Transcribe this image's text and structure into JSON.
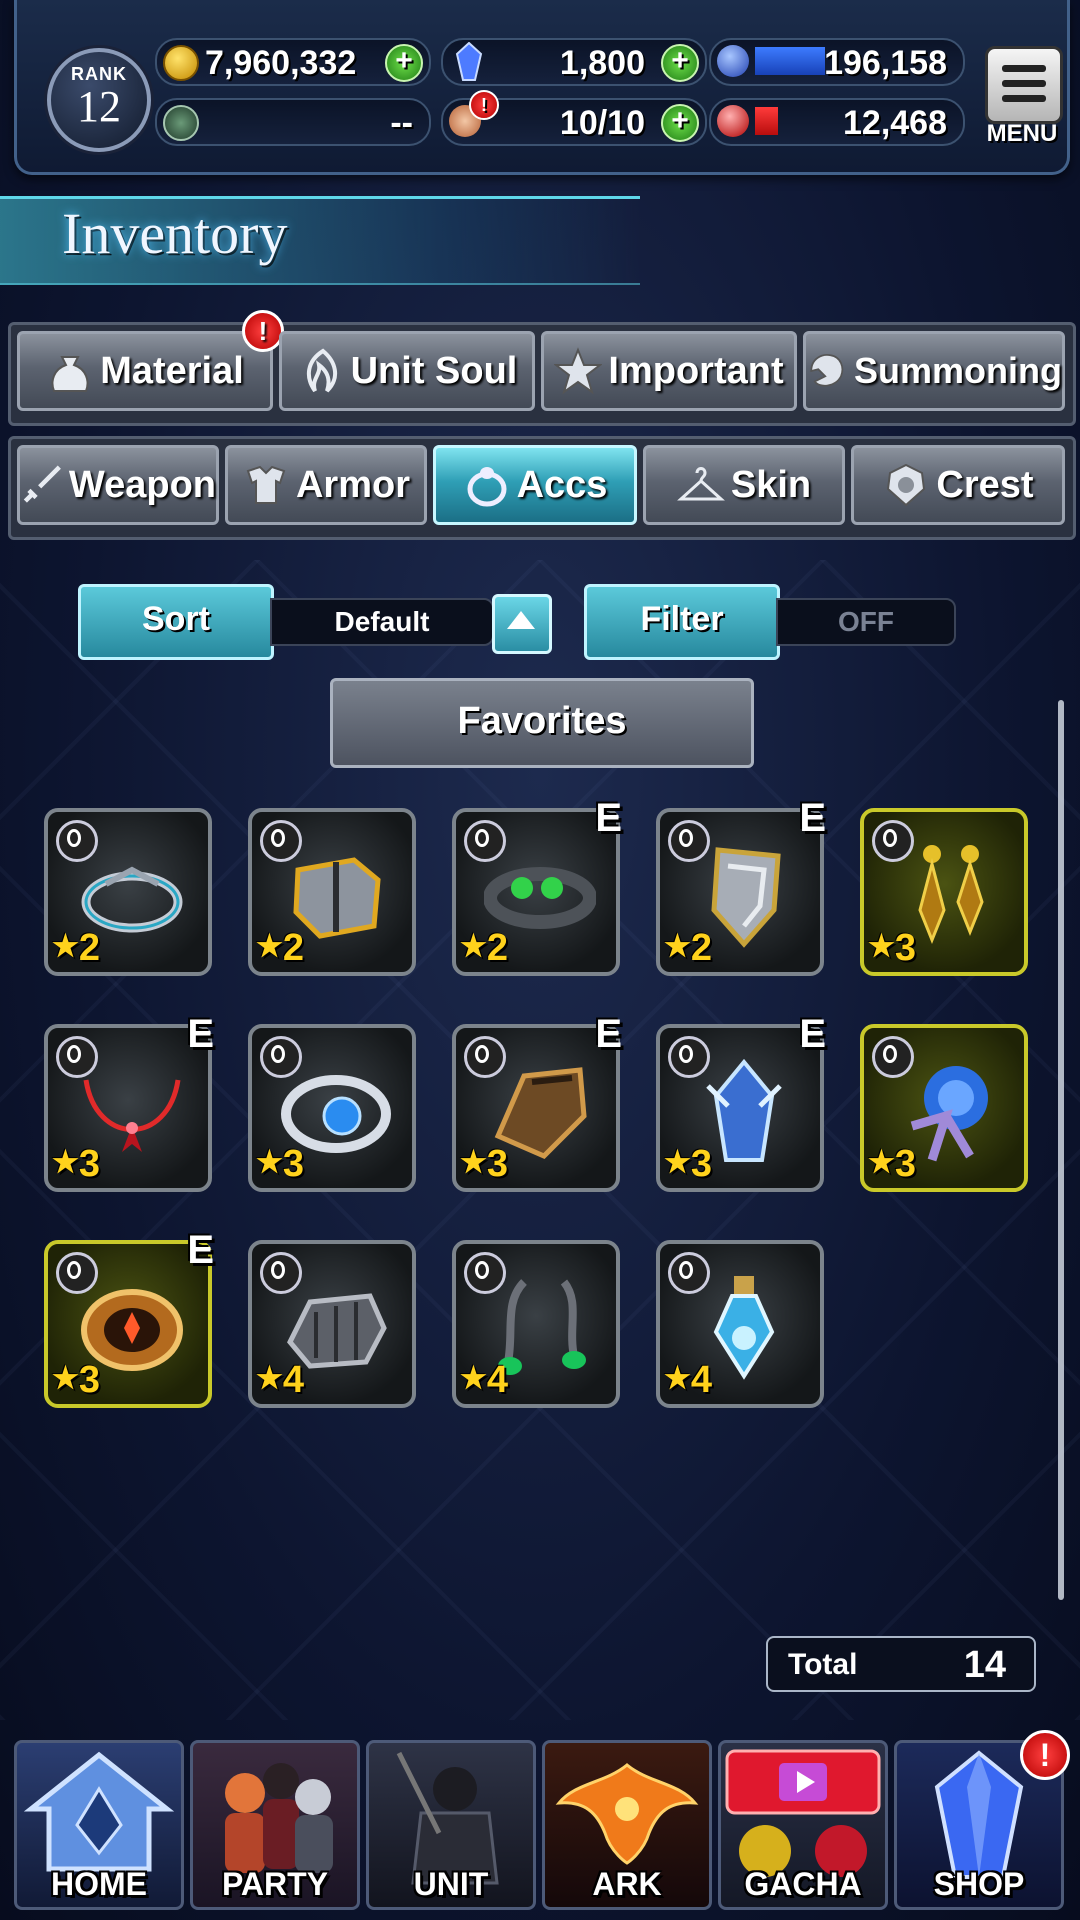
{
  "header": {
    "rank_label": "RANK",
    "rank_value": "12",
    "gil": "7,960,332",
    "lapis": "1,800",
    "blue_value": "196,158",
    "blue_bar_fraction": 0.45,
    "sword_value": "--",
    "stamina": "10/10",
    "red_value": "12,468",
    "red_bar_fraction": 0.15,
    "menu_label": "MENU"
  },
  "title": "Inventory",
  "tabs_row1": [
    {
      "label": "Material",
      "icon": "bag-icon",
      "badge": "!"
    },
    {
      "label": "Unit Soul",
      "icon": "soul-flame-icon"
    },
    {
      "label": "Important",
      "icon": "star-icon"
    },
    {
      "label": "Summoning",
      "icon": "summon-crest-icon"
    }
  ],
  "tabs_row2": [
    {
      "label": "Weapon",
      "icon": "sword-icon"
    },
    {
      "label": "Armor",
      "icon": "armor-icon"
    },
    {
      "label": "Accs",
      "icon": "ring-icon",
      "active": true
    },
    {
      "label": "Skin",
      "icon": "hanger-icon"
    },
    {
      "label": "Crest",
      "icon": "crest-icon"
    }
  ],
  "sort": {
    "button": "Sort",
    "value": "Default"
  },
  "filter": {
    "button": "Filter",
    "value": "OFF"
  },
  "favorites_label": "Favorites",
  "items": [
    {
      "rarity": "2",
      "equipped": false,
      "gold": false,
      "art": "silver-blue-ring"
    },
    {
      "rarity": "2",
      "equipped": false,
      "gold": false,
      "art": "gold-silver-gauntlet"
    },
    {
      "rarity": "2",
      "equipped": true,
      "gold": false,
      "art": "green-gem-bracelet"
    },
    {
      "rarity": "2",
      "equipped": true,
      "gold": false,
      "art": "silver-shield-bracer"
    },
    {
      "rarity": "3",
      "equipped": false,
      "gold": true,
      "art": "gold-earrings"
    },
    {
      "rarity": "3",
      "equipped": true,
      "gold": false,
      "art": "red-necklace"
    },
    {
      "rarity": "3",
      "equipped": false,
      "gold": false,
      "art": "blue-gem-ring"
    },
    {
      "rarity": "3",
      "equipped": true,
      "gold": false,
      "art": "bronze-gauntlet"
    },
    {
      "rarity": "3",
      "equipped": true,
      "gold": false,
      "art": "ice-crystal-bracer"
    },
    {
      "rarity": "3",
      "equipped": false,
      "gold": true,
      "art": "blue-rose-corsage"
    },
    {
      "rarity": "3",
      "equipped": true,
      "gold": true,
      "art": "ornate-bangle"
    },
    {
      "rarity": "4",
      "equipped": false,
      "gold": false,
      "art": "iron-gauntlet"
    },
    {
      "rarity": "4",
      "equipped": false,
      "gold": false,
      "art": "emerald-earrings"
    },
    {
      "rarity": "4",
      "equipped": false,
      "gold": false,
      "art": "crystal-vial"
    }
  ],
  "equipped_mark": "E",
  "total": {
    "label": "Total",
    "value": "14"
  },
  "nav": [
    {
      "label": "HOME",
      "icon": "home-icon"
    },
    {
      "label": "PARTY",
      "icon": "party-icon"
    },
    {
      "label": "UNIT",
      "icon": "unit-icon"
    },
    {
      "label": "ARK",
      "icon": "phoenix-icon"
    },
    {
      "label": "GACHA",
      "icon": "gacha-icon"
    },
    {
      "label": "SHOP",
      "icon": "crystal-icon",
      "badge": "!"
    }
  ],
  "colors": {
    "accent_teal": "#2f9fb6",
    "gold_frame": "#c9c92a",
    "star_yellow": "#ffd21c",
    "badge_red": "#e00000"
  }
}
